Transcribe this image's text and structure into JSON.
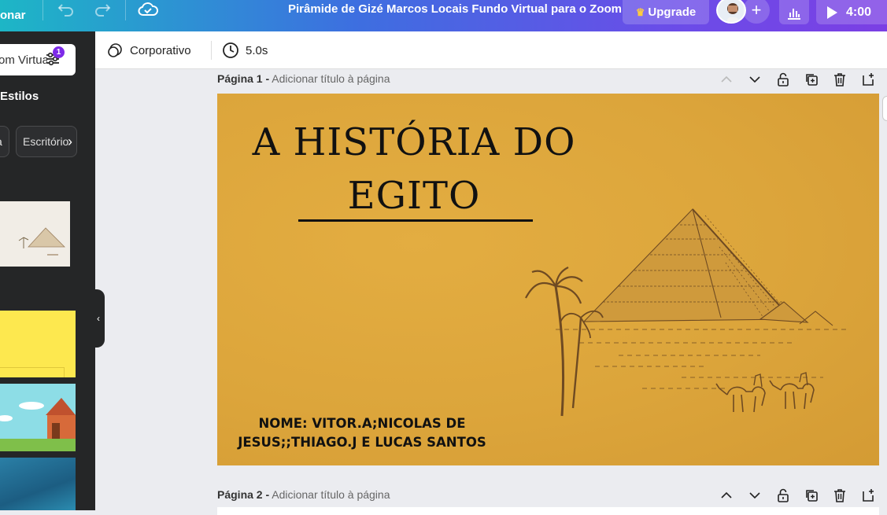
{
  "topbar": {
    "menu_label": "onar",
    "doc_title": "Pirâmide de Gizé Marcos Locais Fundo Virtual para o Zoom",
    "upgrade_label": "Upgrade",
    "play_time": "4:00"
  },
  "sidebar": {
    "search_value": "om Virtua",
    "filter_count": "1",
    "styles_heading": "Estilos",
    "chips": [
      "a",
      "Escritório"
    ]
  },
  "toolbar": {
    "style_label": "Corporativo",
    "duration_label": "5.0s"
  },
  "pages": [
    {
      "label": "Página 1 -",
      "placeholder": "Adicionar título à página"
    },
    {
      "label": "Página 2 -",
      "placeholder": "Adicionar título à página"
    }
  ],
  "slide": {
    "title_line1": "A HISTÓRIA DO",
    "title_line2": "EGITO",
    "names_line1": "NOME: VITOR.A;NICOLAS  DE",
    "names_line2": "JESUS;;THIAGO.J  E  LUCAS SANTOS"
  }
}
